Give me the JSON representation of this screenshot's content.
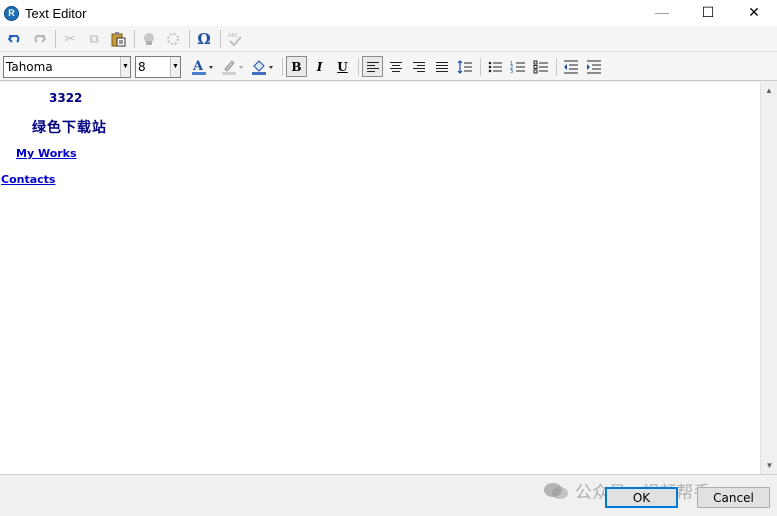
{
  "window": {
    "title": "Text Editor",
    "minimize": "—",
    "maximize": "☐",
    "close": "✕"
  },
  "toolbar1": {
    "undo": "↶",
    "redo": "↷",
    "cut": "✂",
    "copy": "⧉",
    "paste": "📋",
    "link": "🔗",
    "unlink": "⛓",
    "special_char": "Ω",
    "spellcheck": "ABC"
  },
  "format_bar": {
    "font_family": "Tahoma",
    "font_size": "8",
    "bold": "B",
    "italic": "I",
    "underline": "U"
  },
  "document": {
    "lines": [
      "3322",
      "绿色下载站",
      "My Works",
      "Contacts"
    ]
  },
  "buttons": {
    "ok": "OK",
    "cancel": "Cancel"
  },
  "watermark": "公众号 · 视频帮手",
  "colors": {
    "text_blue": "#000080",
    "link_blue": "#0000cc",
    "focus": "#0078d7"
  }
}
